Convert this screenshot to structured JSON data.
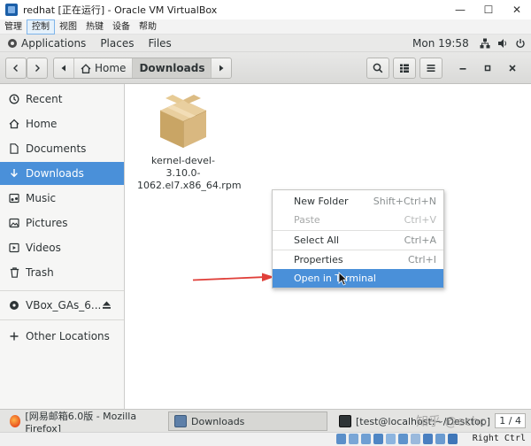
{
  "vbox": {
    "title": "redhat [正在运行] - Oracle VM VirtualBox",
    "menu": [
      "管理",
      "控制",
      "视图",
      "热键",
      "设备",
      "帮助"
    ],
    "host_key": "Right Ctrl"
  },
  "gnome_top": {
    "applications": "Applications",
    "places": "Places",
    "files": "Files",
    "clock": "Mon 19:58"
  },
  "pathbar": {
    "home": "Home",
    "current": "Downloads"
  },
  "sidebar": {
    "items": [
      {
        "label": "Recent",
        "icon": "clock-icon"
      },
      {
        "label": "Home",
        "icon": "home-icon"
      },
      {
        "label": "Documents",
        "icon": "document-icon"
      },
      {
        "label": "Downloads",
        "icon": "download-icon"
      },
      {
        "label": "Music",
        "icon": "music-icon"
      },
      {
        "label": "Pictures",
        "icon": "picture-icon"
      },
      {
        "label": "Videos",
        "icon": "video-icon"
      },
      {
        "label": "Trash",
        "icon": "trash-icon"
      },
      {
        "label": "VBox_GAs_6...",
        "icon": "disc-icon"
      },
      {
        "label": "Other Locations",
        "icon": "plus-icon"
      }
    ],
    "selected": "Downloads"
  },
  "files": [
    {
      "name_line1": "kernel-devel-3.10.0-",
      "name_line2": "1062.el7.x86_64.rpm",
      "icon": "package-icon"
    }
  ],
  "context_menu": {
    "items": [
      {
        "label": "New Folder",
        "accel": "Shift+Ctrl+N",
        "state": "normal"
      },
      {
        "label": "Paste",
        "accel": "Ctrl+V",
        "state": "disabled"
      },
      {
        "label": "Select All",
        "accel": "Ctrl+A",
        "state": "normal"
      },
      {
        "label": "Properties",
        "accel": "Ctrl+I",
        "state": "normal"
      },
      {
        "label": "Open in Terminal",
        "accel": "",
        "state": "highlighted"
      }
    ]
  },
  "taskbar": {
    "tasks": [
      "[网易邮箱6.0版 - Mozilla Firefox]",
      "Downloads",
      "[test@localhost:~/Desktop]"
    ],
    "workspace": "1 / 4"
  },
  "watermark": "知乎 @echo",
  "colors": {
    "accent": "#4a90d9",
    "arrow": "#e0403a"
  }
}
